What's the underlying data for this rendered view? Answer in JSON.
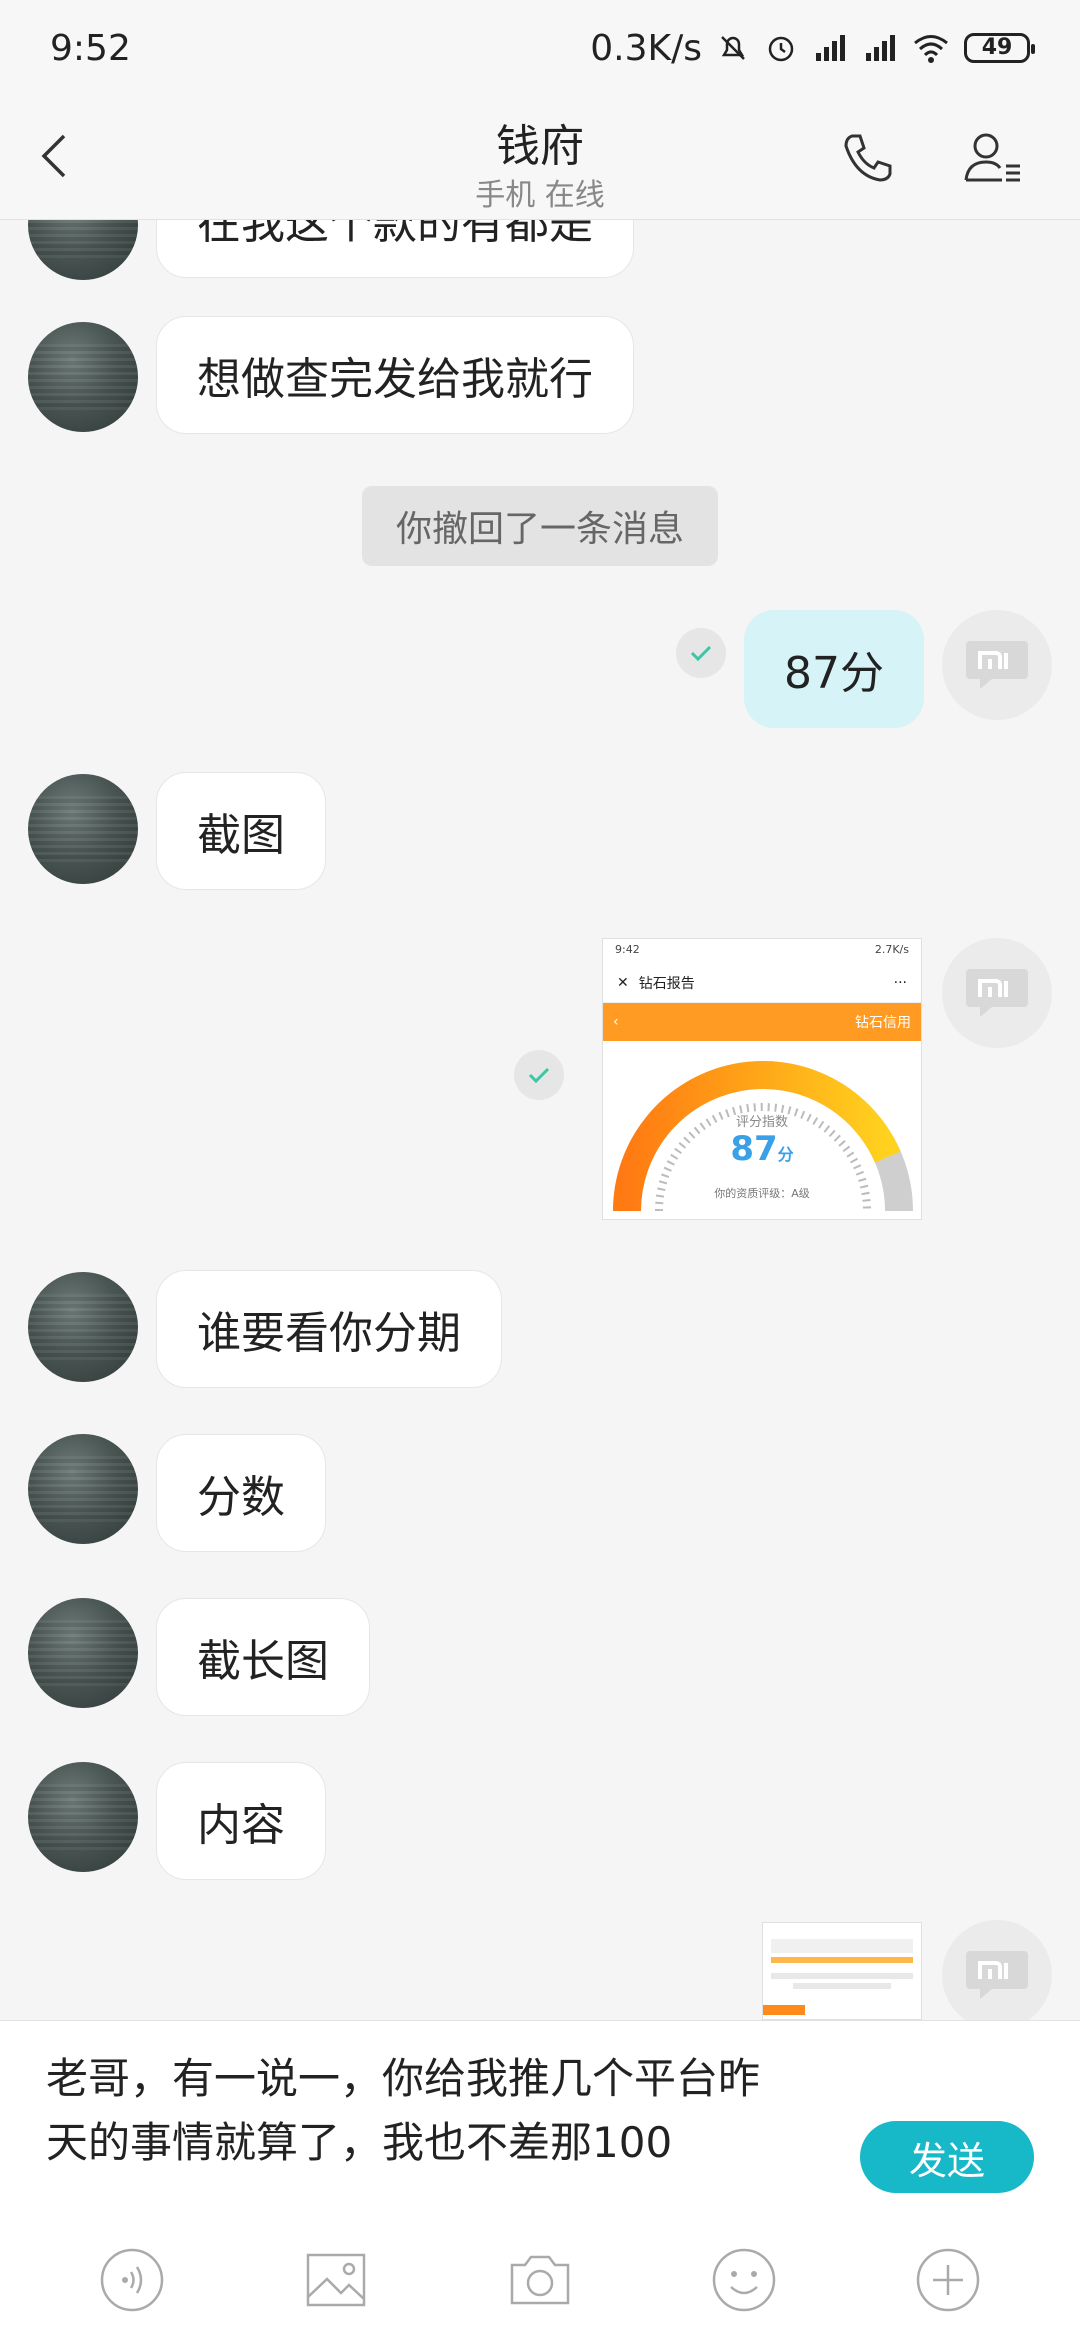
{
  "status_bar": {
    "time": "9:52",
    "network_speed": "0.3K/s",
    "battery": "49",
    "icons": [
      "mute-bell-icon",
      "alarm-icon",
      "hd-signal-icon",
      "signal-icon",
      "wifi-icon",
      "battery-icon"
    ]
  },
  "header": {
    "title": "钱府",
    "subtitle": "手机 在线",
    "icons": [
      "back-icon",
      "phone-icon",
      "profile-icon"
    ]
  },
  "messages": {
    "m0": "在我这个款的有都是",
    "m1": "想做查完发给我就行",
    "system": "你撤回了一条消息",
    "m2": "87分",
    "m3": "截图",
    "m5": "谁要看你分期",
    "m6": "分数",
    "m7": "截长图",
    "m8": "内容"
  },
  "screenshot_thumb": {
    "time": "9:42",
    "status": "2.7K/s",
    "title": "钻石报告",
    "menu": "···",
    "brand": "钻石信用",
    "gauge_label": "评分指数",
    "score": "87",
    "score_unit": "分",
    "grade": "你的资质评级：A级",
    "score_fraction": 0.87
  },
  "input": {
    "text_line1": "老哥，有一说一，你给我推几个平台昨",
    "text_line2": "天的事情就算了，我也不差那100",
    "send_label": "发送"
  },
  "toolbar": {
    "icons": [
      "voice-icon",
      "image-icon",
      "camera-icon",
      "emoji-icon",
      "plus-icon"
    ]
  },
  "colors": {
    "accent": "#17b8c8",
    "out_bubble": "#d6f3f7",
    "check": "#3cc6a6",
    "orange": "#ff9b22"
  }
}
